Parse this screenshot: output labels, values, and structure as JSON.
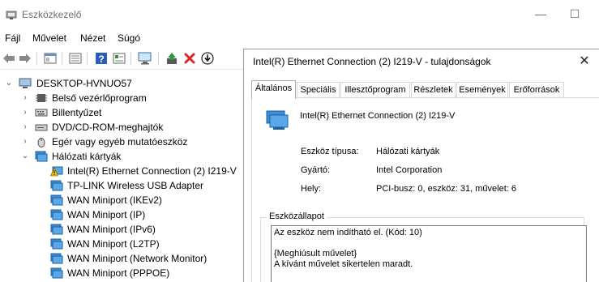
{
  "window": {
    "title": "Eszközkezelő",
    "minimize_glyph": "—",
    "maximize_glyph": "☐"
  },
  "menu": [
    "Fájl",
    "Művelet",
    "Nézet",
    "Súgó"
  ],
  "toolbar": {
    "icons": [
      "back-arrow-icon",
      "forward-arrow-icon",
      "properties-view-icon",
      "list-view-icon",
      "help-icon",
      "details-icon",
      "monitor-scan-icon",
      "update-driver-icon",
      "uninstall-x-icon",
      "disable-device-icon"
    ]
  },
  "tree": {
    "root": "DESKTOP-HVNUO57",
    "categories": [
      {
        "label": "Belső vezérlőprogram",
        "expanded": false
      },
      {
        "label": "Billentyűzet",
        "expanded": false
      },
      {
        "label": "DVD/CD-ROM-meghajtók",
        "expanded": false
      },
      {
        "label": "Egér vagy egyéb mutatóeszköz",
        "expanded": false
      },
      {
        "label": "Hálózati kártyák",
        "expanded": true
      }
    ],
    "network_adapters": [
      {
        "label": "Intel(R) Ethernet Connection (2) I219-V",
        "warning": true
      },
      {
        "label": "TP-LINK Wireless USB Adapter",
        "warning": false
      },
      {
        "label": "WAN Miniport (IKEv2)",
        "warning": false
      },
      {
        "label": "WAN Miniport (IP)",
        "warning": false
      },
      {
        "label": "WAN Miniport (IPv6)",
        "warning": false
      },
      {
        "label": "WAN Miniport (L2TP)",
        "warning": false
      },
      {
        "label": "WAN Miniport (Network Monitor)",
        "warning": false
      },
      {
        "label": "WAN Miniport (PPPOE)",
        "warning": false
      }
    ]
  },
  "dialog": {
    "title": "Intel(R) Ethernet Connection (2) I219-V - tulajdonságok",
    "close_glyph": "✕",
    "tabs": [
      "Általános",
      "Speciális",
      "Illesztőprogram",
      "Részletek",
      "Események",
      "Erőforrások"
    ],
    "active_tab": "Általános",
    "device_name": "Intel(R) Ethernet Connection (2) I219-V",
    "properties": [
      {
        "label": "Eszköz típusa:",
        "value": "Hálózati kártyák"
      },
      {
        "label": "Gyártó:",
        "value": "Intel Corporation"
      },
      {
        "label": "Hely:",
        "value": "PCI-busz: 0, eszköz: 31, művelet: 6"
      }
    ],
    "status_group_title": "Eszközállapot",
    "status_lines": [
      "Az eszköz nem indítható el. (Kód: 10)",
      "",
      "{Meghiúsult művelet}",
      "A kívánt művelet sikertelen maradt."
    ]
  },
  "colors": {
    "network_icon": "#3a8fd6",
    "warning_yellow": "#f2c200",
    "uninstall_red": "#d9262a",
    "help_blue": "#2b5db8"
  }
}
